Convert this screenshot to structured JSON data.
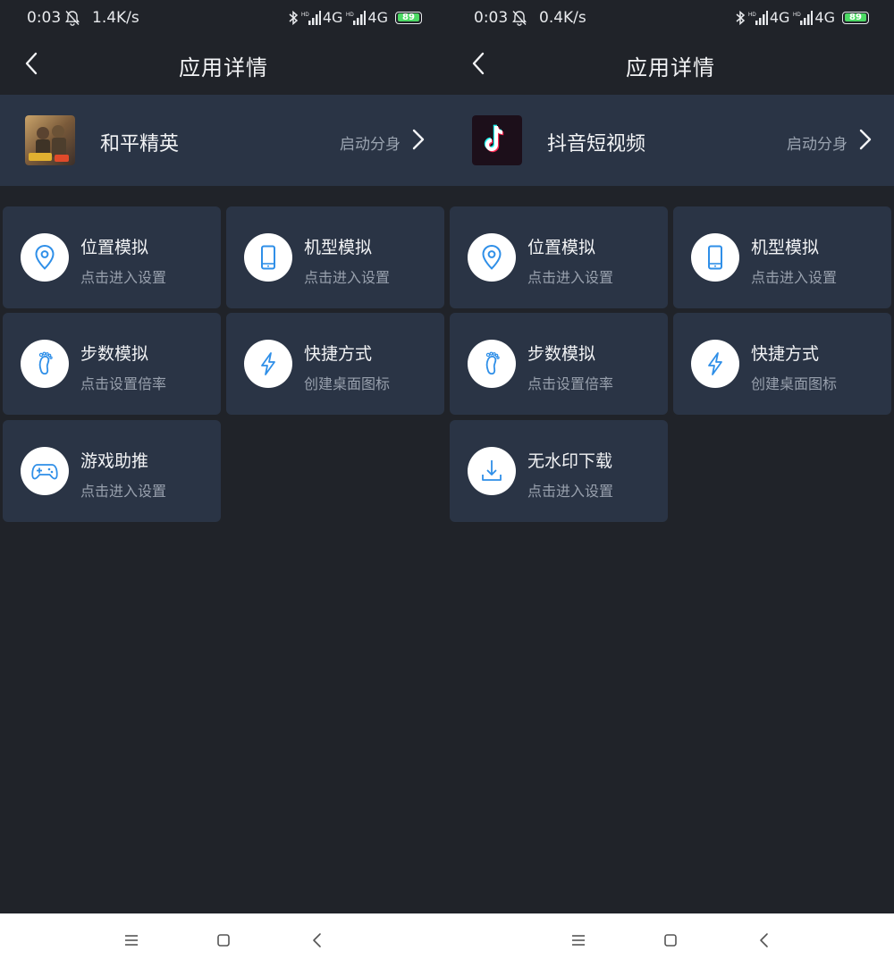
{
  "colors": {
    "background": "#202329",
    "card": "#2a3445",
    "accent_icon": "#2f8fe8",
    "battery": "#4cd964"
  },
  "screens": [
    {
      "status": {
        "time": "0:03",
        "speed": "1.4K/s",
        "net1": "4G",
        "net2": "4G",
        "battery": "89"
      },
      "header": {
        "title": "应用详情"
      },
      "app": {
        "name": "和平精英",
        "action": "启动分身",
        "icon": "game-app-icon"
      },
      "features": [
        {
          "title": "位置模拟",
          "subtitle": "点击进入设置",
          "icon": "location-pin-icon"
        },
        {
          "title": "机型模拟",
          "subtitle": "点击进入设置",
          "icon": "phone-icon"
        },
        {
          "title": "步数模拟",
          "subtitle": "点击设置倍率",
          "icon": "footprint-icon"
        },
        {
          "title": "快捷方式",
          "subtitle": "创建桌面图标",
          "icon": "lightning-icon"
        },
        {
          "title": "游戏助推",
          "subtitle": "点击进入设置",
          "icon": "gamepad-icon"
        }
      ]
    },
    {
      "status": {
        "time": "0:03",
        "speed": "0.4K/s",
        "net1": "4G",
        "net2": "4G",
        "battery": "89"
      },
      "header": {
        "title": "应用详情"
      },
      "app": {
        "name": "抖音短视频",
        "action": "启动分身",
        "icon": "tiktok-icon"
      },
      "features": [
        {
          "title": "位置模拟",
          "subtitle": "点击进入设置",
          "icon": "location-pin-icon"
        },
        {
          "title": "机型模拟",
          "subtitle": "点击进入设置",
          "icon": "phone-icon"
        },
        {
          "title": "步数模拟",
          "subtitle": "点击设置倍率",
          "icon": "footprint-icon"
        },
        {
          "title": "快捷方式",
          "subtitle": "创建桌面图标",
          "icon": "lightning-icon"
        },
        {
          "title": "无水印下载",
          "subtitle": "点击进入设置",
          "icon": "download-icon"
        }
      ]
    }
  ],
  "navbar": {
    "buttons": [
      "menu-icon",
      "home-icon",
      "back-icon"
    ]
  }
}
